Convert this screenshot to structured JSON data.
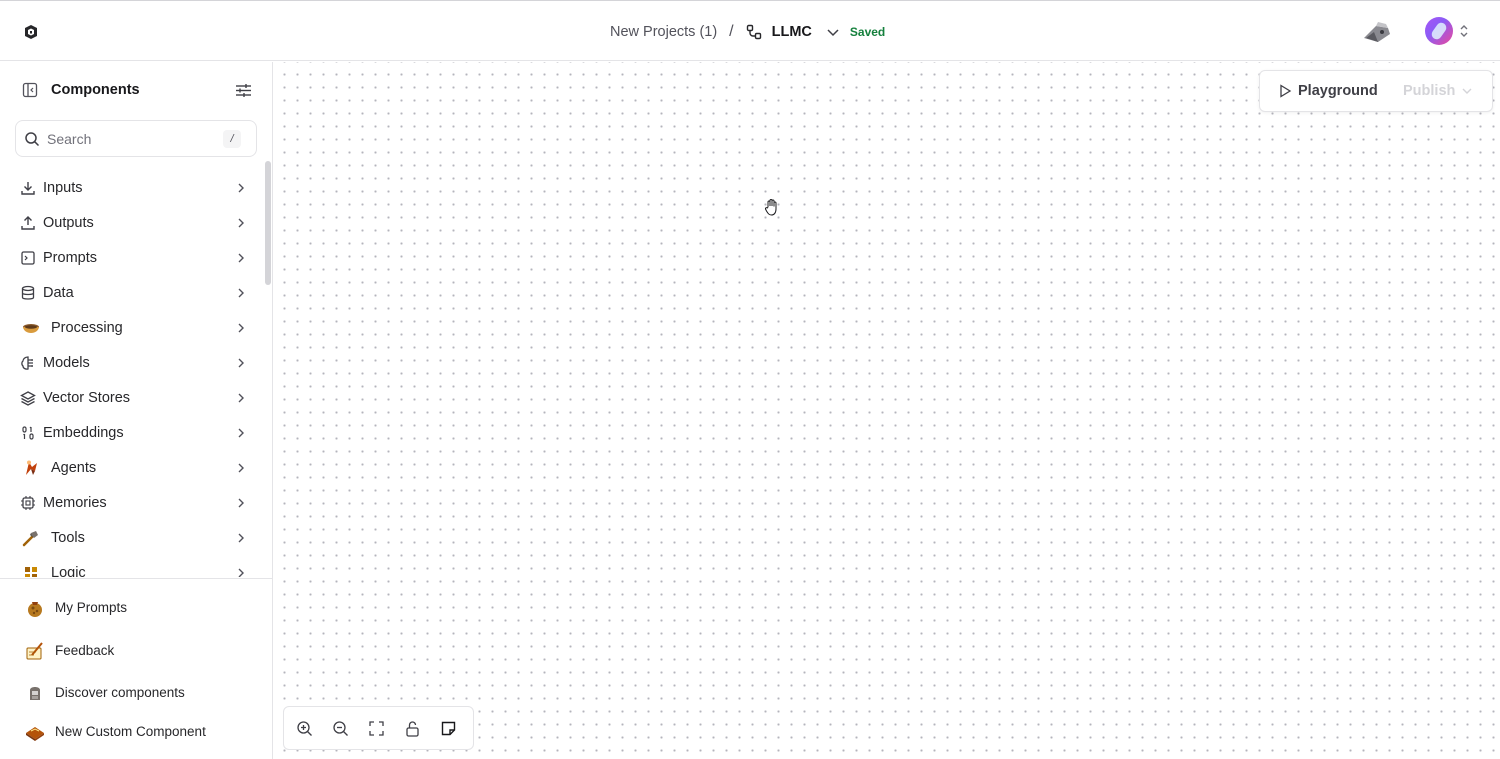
{
  "header": {
    "folder": "New Projects (1)",
    "separator": "/",
    "flow_name": "LLMC",
    "save_status": "Saved"
  },
  "sidebar": {
    "title": "Components",
    "search": {
      "placeholder": "Search",
      "shortcut": "/"
    },
    "categories": [
      {
        "label": "Inputs",
        "icon": "download-icon"
      },
      {
        "label": "Outputs",
        "icon": "upload-icon"
      },
      {
        "label": "Prompts",
        "icon": "terminal-square-icon"
      },
      {
        "label": "Data",
        "icon": "database-icon"
      },
      {
        "label": "Processing",
        "icon": "bowl-emoji-icon"
      },
      {
        "label": "Models",
        "icon": "brain-circuit-icon"
      },
      {
        "label": "Vector Stores",
        "icon": "layers-icon"
      },
      {
        "label": "Embeddings",
        "icon": "binary-icon"
      },
      {
        "label": "Agents",
        "icon": "agent-emoji-icon"
      },
      {
        "label": "Memories",
        "icon": "cpu-icon"
      },
      {
        "label": "Tools",
        "icon": "hammer-emoji-icon"
      },
      {
        "label": "Logic",
        "icon": "logic-emoji-icon"
      }
    ],
    "footer": [
      {
        "label": "My Prompts",
        "icon": "prompts-emoji-icon"
      },
      {
        "label": "Feedback",
        "icon": "feedback-emoji-icon"
      },
      {
        "label": "Discover components",
        "icon": "discover-emoji-icon"
      },
      {
        "label": "New Custom Component",
        "icon": "custom-component-emoji-icon"
      }
    ]
  },
  "canvas": {
    "playground_label": "Playground",
    "publish_label": "Publish"
  },
  "colors": {
    "saved": "#15803d",
    "border": "#e4e4e7",
    "canvas_dot": "#b4b4bc"
  }
}
